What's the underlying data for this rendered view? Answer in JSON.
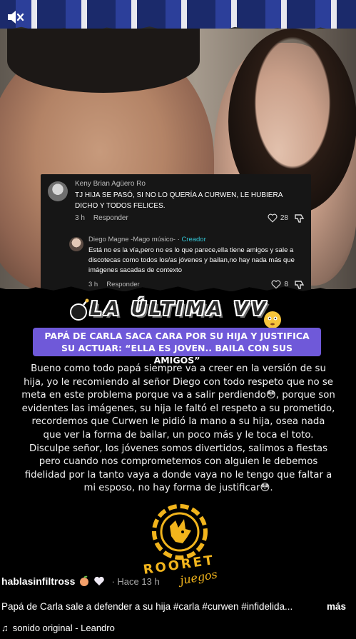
{
  "colors": {
    "accent": "#6f59d9",
    "creator": "#33c6d6",
    "logo_gold": "#f1b41c"
  },
  "top_bar": {
    "mute_icon": "speaker-muted-icon"
  },
  "comment": {
    "author": "Keny Brian Agüero Ro",
    "text": "TJ HIJA SE PASÓ, SI NO LO QUERÍA A CURWEN, LE HUBIERA DICHO Y TODOS FELICES.",
    "time": "3 h",
    "reply_label": "Responder",
    "likes": "28",
    "reply": {
      "author": "Diego Magne -Mago músico-",
      "separator": "·",
      "creator_label": "Creador",
      "text": "Está no es la vía,pero no es lo que parece,ella tiene amigos y sale a discotecas como todos los/as jóvenes y bailan,no hay nada más que imágenes sacadas de contexto",
      "time": "3 h",
      "reply_label": "Responder",
      "likes": "8"
    }
  },
  "show_logo": {
    "text": "LA ÚLTIMA VV"
  },
  "headline": "PAPÁ DE CARLA SACA CARA POR SU HIJA Y JUSTIFICA SU ACTUAR: “ELLA ES JOVEN.. BAILA CON SUS AMIGOS”",
  "body": "Bueno como todo papá siempre va a creer en la versión de su hija, yo le recomiendo al señor Diego con todo respeto que no se meta en este problema porque va a salir perdiendo😳, porque son evidentes las imágenes, su hija le faltó el respeto a su prometido, recordemos que Curwen le pidió la mano a su hija, osea nada que ver la forma de bailar, un poco más y le toca el toto. Disculpe señor, los jóvenes somos divertidos, salimos a fiestas pero cuando nos comprometemos con alguien le debemos fidelidad por la tanto vaya a donde vaya no le tengo que faltar a mi esposo, no hay forma de justificar😳.",
  "brand": {
    "name": "ROORET",
    "sub": "juegos"
  },
  "post": {
    "username": "hablasinfiltross",
    "time": "· Hace 13 h",
    "caption": "Papá de Carla sale a defender a su hija #carla #curwen #infidelida...",
    "more_label": "más",
    "sound": "sonido original - Leandro"
  }
}
